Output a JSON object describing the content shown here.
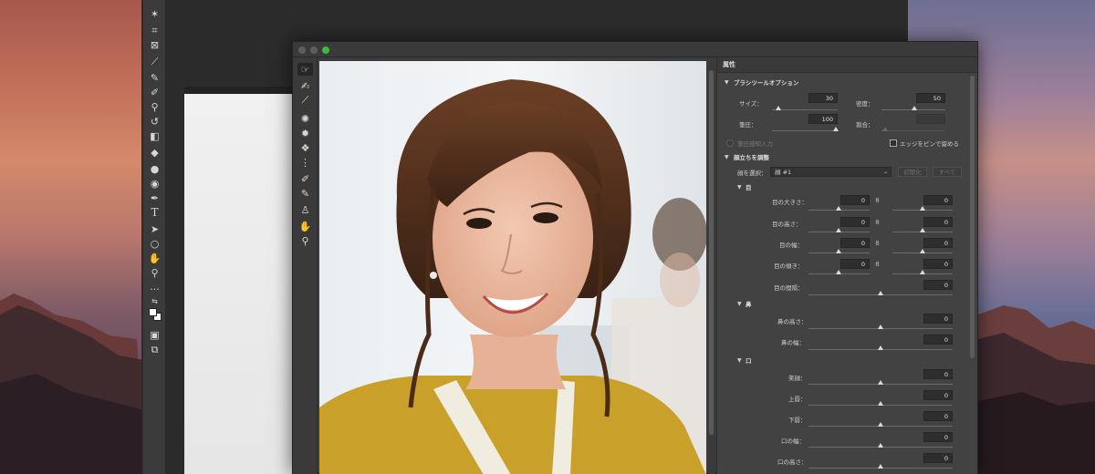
{
  "colors": {
    "window_bg": "#3c3c3c",
    "panel_bg": "#424242",
    "accent_green": "#3dbb3a",
    "field_bg": "#2e2e2e"
  },
  "back_tools": [
    "wand-icon",
    "crop-icon",
    "frame-icon",
    "eyedropper-icon",
    "brush-icon",
    "pencil-icon",
    "stamp-icon",
    "history-brush-icon",
    "eraser-icon",
    "bucket-icon",
    "drop-icon",
    "dodge-icon",
    "pen-icon",
    "type-icon",
    "path-select-icon",
    "ellipse-icon",
    "hand-icon",
    "zoom-icon",
    "more-icon",
    "color-swap-icon",
    "color-swatch-icon",
    "quickmask-icon",
    "screen-mode-icon"
  ],
  "inner_tools": [
    "forward-warp-icon",
    "reconstruct-icon",
    "smooth-icon",
    "twirl-icon",
    "pucker-icon",
    "bloat-icon",
    "push-left-icon",
    "freeze-mask-icon",
    "thaw-mask-icon",
    "face-tool-icon",
    "hand-icon",
    "zoom-icon"
  ],
  "panel": {
    "title": "属性",
    "brush_section": "ブラシツールオプション",
    "size_label": "サイズ：",
    "size_value": "30",
    "density_label": "密度：",
    "density_value": "50",
    "pressure_label": "筆圧：",
    "pressure_value": "100",
    "rate_label": "割合：",
    "rate_value": "",
    "stylus_label": "筆圧感知入力",
    "pin_edges_label": "エッジをピンで留める",
    "face_section": "顔立ちを調整",
    "select_face_label": "顔を選択：",
    "select_face_value": "顔 #1",
    "reset_button": "初期化",
    "all_button": "すべて",
    "eyes_section": "目",
    "eye_size_label": "目の大きさ：",
    "eye_height_label": "目の高さ：",
    "eye_width_label": "目の幅：",
    "eye_tilt_label": "目の傾き：",
    "eye_distance_label": "目の間隔：",
    "nose_section": "鼻",
    "nose_height_label": "鼻の高さ：",
    "nose_width_label": "鼻の幅：",
    "mouth_section": "口",
    "smile_label": "笑顔：",
    "upper_lip_label": "上唇：",
    "lower_lip_label": "下唇：",
    "mouth_width_label": "口の幅：",
    "mouth_height_label": "口の高さ：",
    "zero": "0"
  }
}
